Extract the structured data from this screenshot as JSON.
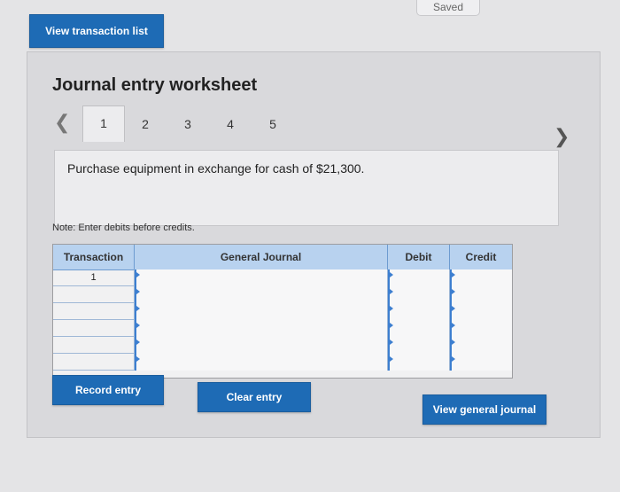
{
  "status": {
    "saved_label": "Saved"
  },
  "top_nav": {
    "view_transaction_list": "View transaction list"
  },
  "worksheet": {
    "title": "Journal entry worksheet",
    "pager": {
      "tabs": [
        "1",
        "2",
        "3",
        "4",
        "5"
      ],
      "active_index": 0
    },
    "transaction_description": "Purchase equipment in exchange for cash of $21,300.",
    "note": "Note: Enter debits before credits."
  },
  "journal_table": {
    "headers": {
      "transaction": "Transaction",
      "general_journal": "General Journal",
      "debit": "Debit",
      "credit": "Credit"
    },
    "rows": [
      {
        "transaction": "1",
        "account": "",
        "debit": "",
        "credit": ""
      },
      {
        "transaction": "",
        "account": "",
        "debit": "",
        "credit": ""
      },
      {
        "transaction": "",
        "account": "",
        "debit": "",
        "credit": ""
      },
      {
        "transaction": "",
        "account": "",
        "debit": "",
        "credit": ""
      },
      {
        "transaction": "",
        "account": "",
        "debit": "",
        "credit": ""
      },
      {
        "transaction": "",
        "account": "",
        "debit": "",
        "credit": ""
      }
    ]
  },
  "actions": {
    "record_entry": "Record entry",
    "clear_entry": "Clear entry",
    "view_general_journal": "View general journal"
  },
  "colors": {
    "button_blue": "#1e6bb5",
    "table_header_blue": "#b8d2ef",
    "panel_gray": "#d9d9dc",
    "page_background": "#e4e4e6"
  },
  "icons": {
    "pager_prev": "chevron-left-icon",
    "pager_next": "chevron-right-icon"
  }
}
